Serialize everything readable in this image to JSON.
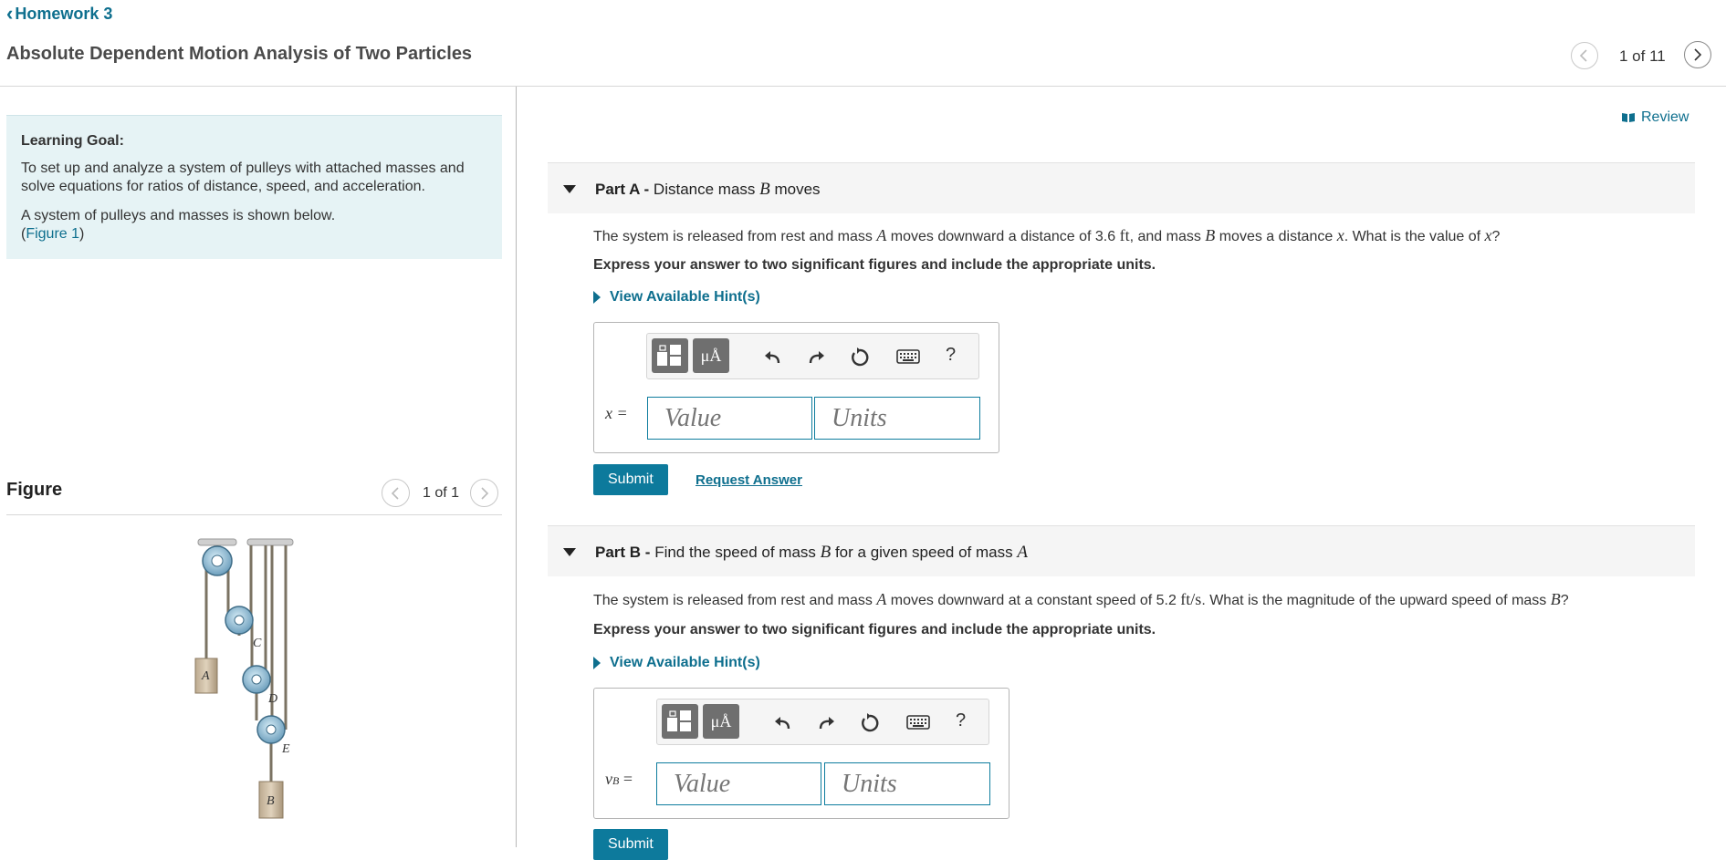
{
  "header": {
    "back_label": "Homework 3",
    "title": "Absolute Dependent Motion Analysis of Two Particles",
    "pager": "1 of 11"
  },
  "goal": {
    "heading": "Learning Goal:",
    "text": "To set up and analyze a system of pulleys with attached masses and solve equations for ratios of distance, speed, and acceleration.",
    "text2": "A system of pulleys and masses is shown below.",
    "figure_link": "Figure 1",
    "open_paren": "(",
    "close_paren": ")"
  },
  "figure": {
    "title": "Figure",
    "pager": "1 of 1",
    "labels": {
      "A": "A",
      "B": "B",
      "C": "C",
      "D": "D",
      "E": "E"
    }
  },
  "review_label": "Review",
  "parts": [
    {
      "prefix": "Part A - ",
      "title_pre": "Distance mass ",
      "title_var": "B",
      "title_post": " moves",
      "question_1": "The system is released from rest and mass ",
      "question_var_a": "A",
      "question_2": " moves downward a distance of 3.6 ",
      "question_unit": "ft",
      "question_3": ", and mass ",
      "question_var_b": "B",
      "question_4": " moves a distance ",
      "question_var_x": "x",
      "question_5": ". What is the value of ",
      "question_var_x2": "x",
      "question_6": "?",
      "instruction": "Express your answer to two significant figures and include the appropriate units.",
      "hint_label": "View Available Hint(s)",
      "variable": "x =",
      "value_placeholder": "Value",
      "units_placeholder": "Units",
      "submit_label": "Submit",
      "request_label": "Request Answer"
    },
    {
      "prefix": "Part B - ",
      "title_pre": "Find the speed of mass ",
      "title_var": "B",
      "title_mid": " for a given speed of mass ",
      "title_var2": "A",
      "question_1": "The system is released from rest and mass ",
      "question_var_a": "A",
      "question_2": " moves downward at a constant speed of 5.2 ",
      "question_unit": "ft/s",
      "question_3": ". What is the magnitude of the upward speed of mass ",
      "question_var_b": "B",
      "question_4": "?",
      "instruction": "Express your answer to two significant figures and include the appropriate units.",
      "hint_label": "View Available Hint(s)",
      "variable_main": "v",
      "variable_sub": "B",
      "variable_eq": " =",
      "value_placeholder": "Value",
      "units_placeholder": "Units",
      "submit_label": "Submit"
    }
  ],
  "toolbar": {
    "templates_icon": "templates-icon",
    "units_symbol": "μÅ",
    "help_label": "?"
  },
  "colors": {
    "accent": "#0d7a9c",
    "goal_bg": "#e6f3f5",
    "input_border": "#0e7d9e"
  }
}
